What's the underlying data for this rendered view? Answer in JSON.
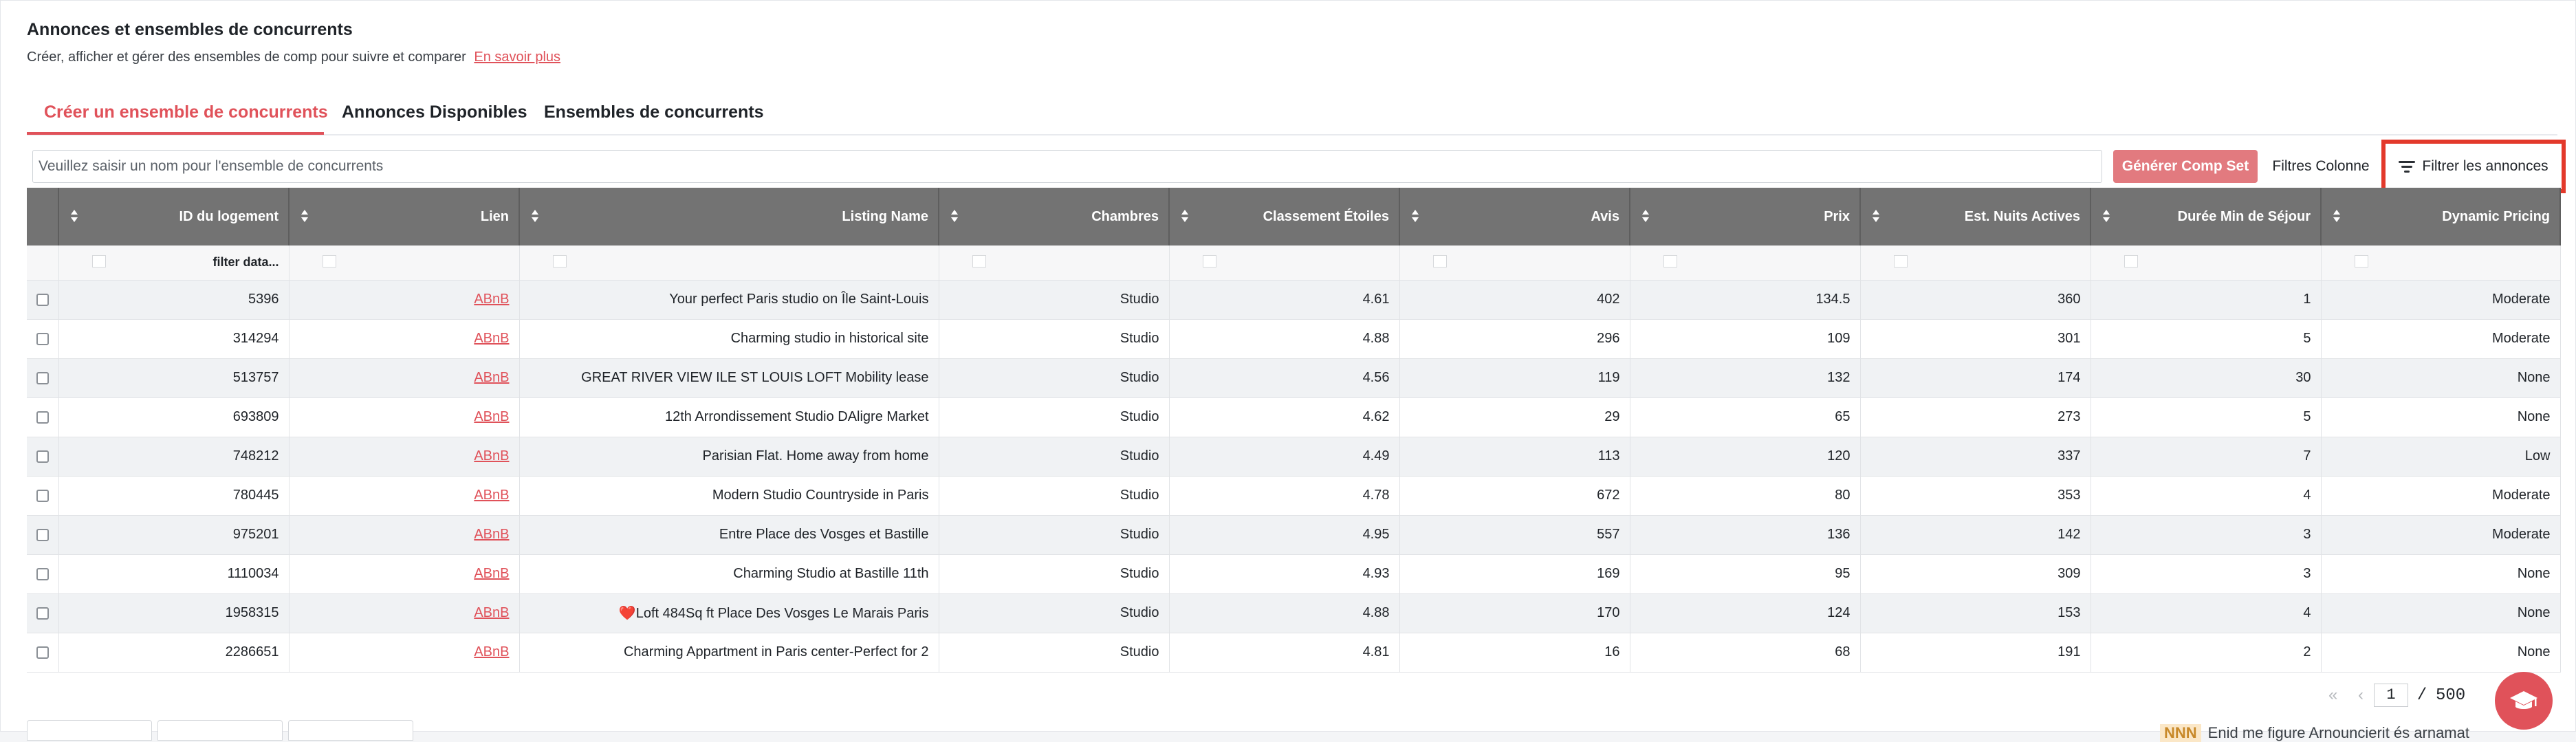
{
  "header": {
    "title": "Annonces et ensembles de concurrents",
    "subtitle": "Créer, afficher et gérer des ensembles de comp pour suivre et comparer",
    "learn_more": "En savoir plus"
  },
  "tabs": [
    {
      "label": "Créer un ensemble de concurrents",
      "active": true
    },
    {
      "label": "Annonces Disponibles",
      "active": false
    },
    {
      "label": "Ensembles de concurrents",
      "active": false
    }
  ],
  "toolbar": {
    "name_placeholder": "Veuillez saisir un nom pour l'ensemble de concurrents",
    "generate_label": "Générer Comp Set",
    "columns_label": "Filtres Colonne",
    "filter_label": "Filtrer les annonces"
  },
  "table": {
    "columns": [
      "ID du logement",
      "Lien",
      "Listing Name",
      "Chambres",
      "Classement Étoiles",
      "Avis",
      "Prix",
      "Est. Nuits Actives",
      "Durée Min de Séjour",
      "Dynamic Pricing"
    ],
    "filter_placeholder": "filter data...",
    "rows": [
      {
        "id": "5396",
        "link": "ABnB",
        "name": "Your perfect Paris studio on Île Saint-Louis",
        "rooms": "Studio",
        "stars": "4.61",
        "reviews": "402",
        "price": "134.5",
        "nights": "360",
        "min_stay": "1",
        "pricing": "Moderate"
      },
      {
        "id": "314294",
        "link": "ABnB",
        "name": "Charming studio in historical site",
        "rooms": "Studio",
        "stars": "4.88",
        "reviews": "296",
        "price": "109",
        "nights": "301",
        "min_stay": "5",
        "pricing": "Moderate"
      },
      {
        "id": "513757",
        "link": "ABnB",
        "name": "GREAT RIVER VIEW ILE ST LOUIS LOFT Mobility lease",
        "rooms": "Studio",
        "stars": "4.56",
        "reviews": "119",
        "price": "132",
        "nights": "174",
        "min_stay": "30",
        "pricing": "None"
      },
      {
        "id": "693809",
        "link": "ABnB",
        "name": "12th Arrondissement Studio DAligre Market",
        "rooms": "Studio",
        "stars": "4.62",
        "reviews": "29",
        "price": "65",
        "nights": "273",
        "min_stay": "5",
        "pricing": "None"
      },
      {
        "id": "748212",
        "link": "ABnB",
        "name": "Parisian Flat. Home away from home",
        "rooms": "Studio",
        "stars": "4.49",
        "reviews": "113",
        "price": "120",
        "nights": "337",
        "min_stay": "7",
        "pricing": "Low"
      },
      {
        "id": "780445",
        "link": "ABnB",
        "name": "Modern Studio Countryside in Paris",
        "rooms": "Studio",
        "stars": "4.78",
        "reviews": "672",
        "price": "80",
        "nights": "353",
        "min_stay": "4",
        "pricing": "Moderate"
      },
      {
        "id": "975201",
        "link": "ABnB",
        "name": "Entre Place des Vosges et Bastille",
        "rooms": "Studio",
        "stars": "4.95",
        "reviews": "557",
        "price": "136",
        "nights": "142",
        "min_stay": "3",
        "pricing": "Moderate"
      },
      {
        "id": "1110034",
        "link": "ABnB",
        "name": "Charming Studio at Bastille 11th",
        "rooms": "Studio",
        "stars": "4.93",
        "reviews": "169",
        "price": "95",
        "nights": "309",
        "min_stay": "3",
        "pricing": "None"
      },
      {
        "id": "1958315",
        "link": "ABnB",
        "name": "❤️Loft 484Sq ft Place Des Vosges Le Marais Paris",
        "rooms": "Studio",
        "stars": "4.88",
        "reviews": "170",
        "price": "124",
        "nights": "153",
        "min_stay": "4",
        "pricing": "None"
      },
      {
        "id": "2286651",
        "link": "ABnB",
        "name": "Charming Appartment in Paris center-Perfect for 2",
        "rooms": "Studio",
        "stars": "4.81",
        "reviews": "16",
        "price": "68",
        "nights": "191",
        "min_stay": "2",
        "pricing": "None"
      }
    ]
  },
  "pagination": {
    "first_icon": "«",
    "prev_icon": "‹",
    "current": "1",
    "separator": "/",
    "total": "500"
  },
  "footer": {
    "badge": "NNN",
    "note": "Enid me figure Arnouncierit és arnamat"
  },
  "icons": {
    "filter": "filter-lines-icon",
    "sort": "sort-icon",
    "help": "graduation-cap-icon"
  },
  "colors": {
    "accent": "#e0525a",
    "header_bg": "#737373",
    "highlight_border": "#e3392b"
  }
}
